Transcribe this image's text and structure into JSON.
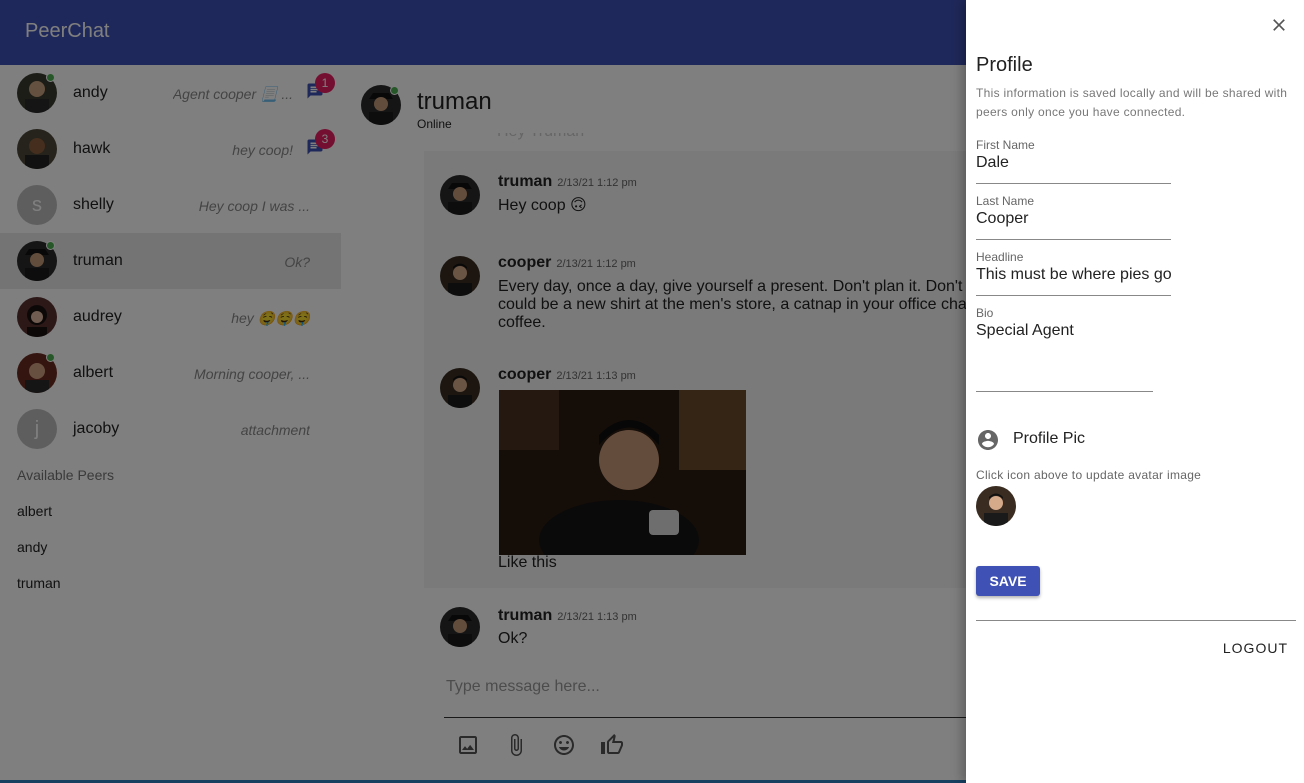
{
  "app": {
    "title": "PeerChat"
  },
  "conversations": [
    {
      "name": "andy",
      "preview": "Agent cooper 📃 ...",
      "badge": "1",
      "online": true,
      "avatar": "photo"
    },
    {
      "name": "hawk",
      "preview": "hey coop!",
      "badge": "3",
      "online": false,
      "avatar": "photo"
    },
    {
      "name": "shelly",
      "preview": "Hey coop I was ...",
      "online": false,
      "avatar": "letter",
      "letter": "s"
    },
    {
      "name": "truman",
      "preview": "Ok?",
      "online": true,
      "avatar": "photo",
      "selected": true
    },
    {
      "name": "audrey",
      "preview": "hey 🤤🤤🤤",
      "online": false,
      "avatar": "photo"
    },
    {
      "name": "albert",
      "preview": "Morning cooper, ...",
      "online": true,
      "avatar": "photo"
    },
    {
      "name": "jacoby",
      "preview": "attachment",
      "online": false,
      "avatar": "letter",
      "letter": "j"
    }
  ],
  "available_peers": {
    "header": "Available Peers",
    "items": [
      "albert",
      "andy",
      "truman"
    ]
  },
  "chat": {
    "peer_name": "truman",
    "peer_status": "Online",
    "ghost_message": "Hey Truman",
    "messages": [
      {
        "author": "truman",
        "time": "2/13/21 1:12 pm",
        "text": "Hey coop 🙃"
      },
      {
        "author": "cooper",
        "time": "2/13/21 1:12 pm",
        "text": "Every day, once a day, give yourself a present. Don't plan it. Don't could be a new shirt at the men's store, a catnap in your office cha coffee."
      },
      {
        "author": "cooper",
        "time": "2/13/21 1:13 pm",
        "text": "Like this"
      },
      {
        "author": "truman",
        "time": "2/13/21 1:13 pm",
        "text": "Ok?"
      }
    ],
    "composer_placeholder": "Type message here..."
  },
  "profile": {
    "heading": "Profile",
    "description": "This information is saved locally and will be shared with peers only once you have connected.",
    "fields": {
      "first_name": {
        "label": "First Name",
        "value": "Dale"
      },
      "last_name": {
        "label": "Last Name",
        "value": "Cooper"
      },
      "headline": {
        "label": "Headline",
        "value": "This must be where pies go"
      },
      "bio": {
        "label": "Bio",
        "value": "Special Agent"
      }
    },
    "profile_pic_label": "Profile Pic",
    "profile_pic_hint": "Click icon above to update avatar image",
    "save_label": "SAVE",
    "logout_label": "LOGOUT"
  },
  "colors": {
    "primary": "#3f51b5",
    "badge": "#e91e63",
    "online": "#4caf50",
    "overlay": "rgba(0,0,0,0.5)"
  }
}
